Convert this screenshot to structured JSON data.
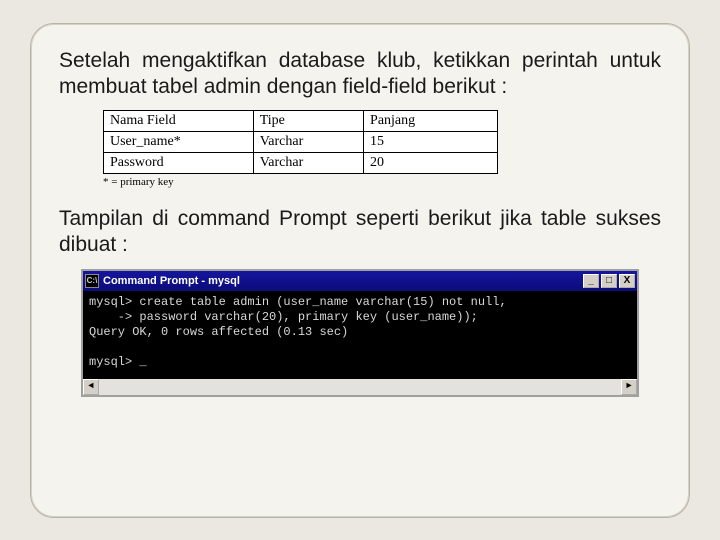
{
  "para1": "Setelah mengaktifkan database klub, ketikkan perintah untuk membuat tabel admin dengan field-field berikut :",
  "table": {
    "headers": [
      "Nama Field",
      "Tipe",
      "Panjang"
    ],
    "rows": [
      [
        "User_name*",
        "Varchar",
        "15"
      ],
      [
        "Password",
        "Varchar",
        "20"
      ]
    ],
    "footnote": "* = primary key"
  },
  "para2": "Tampilan di command Prompt seperti berikut jika table sukses dibuat :",
  "cmd": {
    "icon_label": "C:\\",
    "title": "Command Prompt - mysql",
    "min": "_",
    "max": "□",
    "close": "X",
    "content": "mysql> create table admin (user_name varchar(15) not null,\n    -> password varchar(20), primary key (user_name));\nQuery OK, 0 rows affected (0.13 sec)\n\nmysql> _",
    "left": "◄",
    "right": "►"
  }
}
